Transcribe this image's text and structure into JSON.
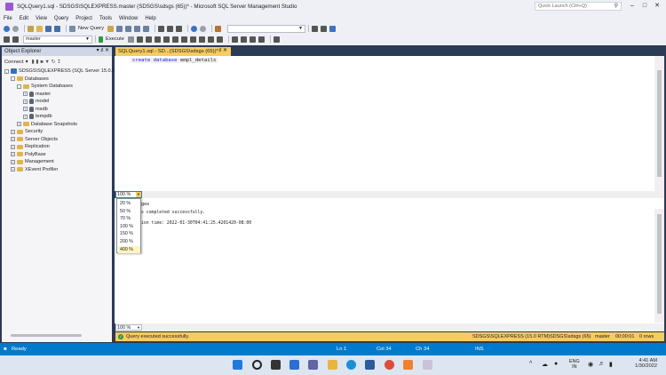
{
  "window": {
    "title": "SQLQuery1.sql - SDSGS\\SQLEXPRESS.master (SDSGS\\sdsgs (65))* - Microsoft SQL Server Management Studio",
    "quick_launch_placeholder": "Quick Launch (Ctrl+Q)"
  },
  "menu": [
    "File",
    "Edit",
    "View",
    "Query",
    "Project",
    "Tools",
    "Window",
    "Help"
  ],
  "toolbar": {
    "new_query": "New Query",
    "database_combo": "master",
    "execute": "Execute"
  },
  "object_explorer": {
    "title": "Object Explorer",
    "connect": "Connect",
    "tree": [
      {
        "label": "SDSGS\\SQLEXPRESS (SQL Server 15.0.2000",
        "level": 0,
        "kind": "server",
        "expander": "-"
      },
      {
        "label": "Databases",
        "level": 1,
        "kind": "folder",
        "expander": "-"
      },
      {
        "label": "System Databases",
        "level": 2,
        "kind": "folder",
        "expander": "-"
      },
      {
        "label": "master",
        "level": 3,
        "kind": "db",
        "expander": "+"
      },
      {
        "label": "model",
        "level": 3,
        "kind": "db",
        "expander": "+"
      },
      {
        "label": "msdb",
        "level": 3,
        "kind": "db",
        "expander": "+"
      },
      {
        "label": "tempdb",
        "level": 3,
        "kind": "db",
        "expander": "+"
      },
      {
        "label": "Database Snapshots",
        "level": 2,
        "kind": "folder",
        "expander": "+"
      },
      {
        "label": "Security",
        "level": 1,
        "kind": "folder",
        "expander": "+"
      },
      {
        "label": "Server Objects",
        "level": 1,
        "kind": "folder",
        "expander": "+"
      },
      {
        "label": "Replication",
        "level": 1,
        "kind": "folder",
        "expander": "+"
      },
      {
        "label": "PolyBase",
        "level": 1,
        "kind": "folder",
        "expander": "+"
      },
      {
        "label": "Management",
        "level": 1,
        "kind": "folder",
        "expander": "+"
      },
      {
        "label": "XEvent Profiler",
        "level": 1,
        "kind": "folder",
        "expander": "+"
      }
    ]
  },
  "editor": {
    "tab_label": "SQLQuery1.sql - SD...(SDSGS\\sdsgs (65))*",
    "code": {
      "kw1": "create",
      "kw2": "database",
      "name": "empl_details"
    },
    "zoom": "100 %"
  },
  "zoom_options": [
    "20 %",
    "50 %",
    "70 %",
    "100 %",
    "150 %",
    "200 %",
    "400 %"
  ],
  "results": {
    "tab": "ges",
    "line1": "s completed successfully.",
    "line2": "ion time: 2022-01-30T04:41:25.4201420-08:00",
    "zoom": "100 %"
  },
  "query_status": {
    "message": "Query executed successfully.",
    "server": "SDSGS\\SQLEXPRESS (15.0 RTM)",
    "user": "SDSGS\\sdsgs (65)",
    "database": "master",
    "time": "00:00:01",
    "rows": "0 rows"
  },
  "statusbar": {
    "ready": "Ready",
    "ln": "Ln 1",
    "col": "Col 34",
    "ch": "Ch 34",
    "ins": "INS"
  },
  "taskbar": {
    "lang1": "ENG",
    "lang2": "IN",
    "time": "4:41 AM",
    "date": "1/30/2022"
  },
  "colors": {
    "accent": "#007acc",
    "frame": "#2b3a55",
    "highlight": "#f5cc5f",
    "keyword": "#1a1ae6"
  }
}
